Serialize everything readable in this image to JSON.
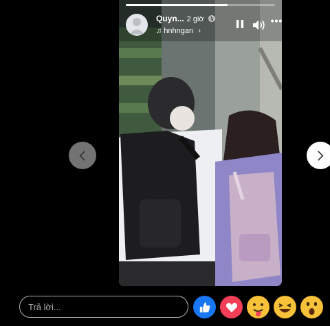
{
  "story": {
    "author": "Quyn...",
    "time": "2 giờ",
    "music": "hnhngan",
    "progress": 0.68,
    "image_desc_icon": "story-photo"
  },
  "controls": {
    "pause_icon": "pause-icon",
    "volume_icon": "volume-icon",
    "more_icon": "more-icon"
  },
  "reply": {
    "placeholder": "Trả lời..."
  },
  "reactions": [
    {
      "name": "like",
      "color": "#1877f2"
    },
    {
      "name": "love",
      "color": "#f33e58"
    },
    {
      "name": "care",
      "color": "#f7b125"
    },
    {
      "name": "haha",
      "color": "#f7b125"
    },
    {
      "name": "wow",
      "color": "#f7b125"
    }
  ]
}
